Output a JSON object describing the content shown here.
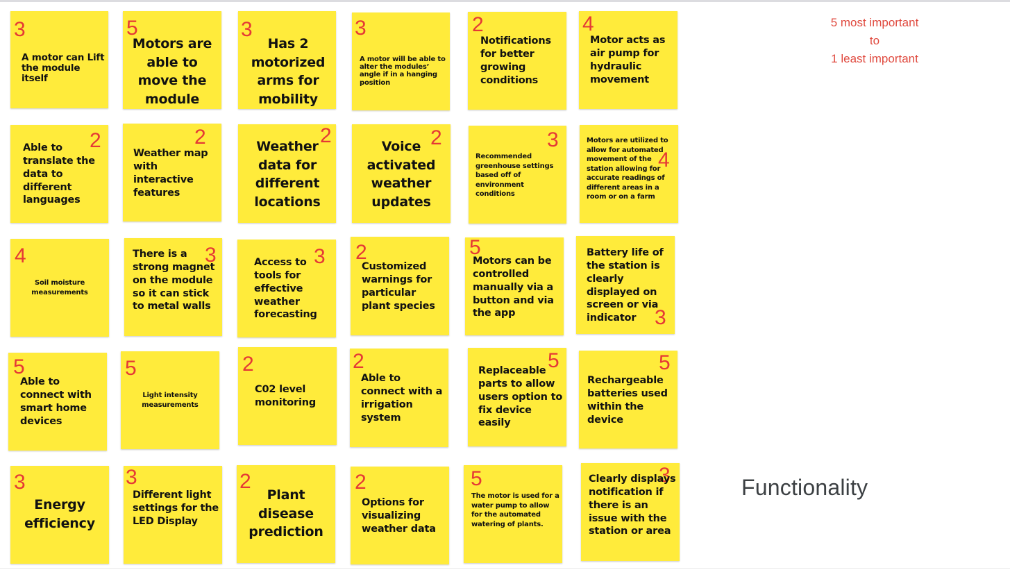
{
  "legend": {
    "line1": "5 most important",
    "line2": "to",
    "line3": "1 least important",
    "color": "#e04a3f"
  },
  "category_title": "Functionality",
  "note_color": "#ffeb3b",
  "score_color": "#e53935",
  "notes": [
    {
      "score": "3",
      "text": "A motor can Lift the module itself"
    },
    {
      "score": "5",
      "text": "Motors are able to move the module"
    },
    {
      "score": "3",
      "text": "Has 2 motorized arms for mobility"
    },
    {
      "score": "3",
      "text": "A motor will be able to alter the modules’ angle if in a hanging position"
    },
    {
      "score": "2",
      "text": "Notifications for better growing conditions"
    },
    {
      "score": "4",
      "text": "Motor acts as air pump for hydraulic movement"
    },
    {
      "score": "2",
      "text": "Able to translate the data to different languages"
    },
    {
      "score": "2",
      "text": "Weather map with interactive features"
    },
    {
      "score": "2",
      "text": "Weather data for different locations"
    },
    {
      "score": "2",
      "text": "Voice activated weather updates"
    },
    {
      "score": "3",
      "text": "Recommended greenhouse settings based off of environment conditions"
    },
    {
      "score": "4",
      "text": "Motors are utilized to allow for automated movement of the station allowing for accurate readings of different areas in a room or on a farm"
    },
    {
      "score": "4",
      "text": "Soil moisture measurements"
    },
    {
      "score": "3",
      "text": "There is a strong magnet on the module so it can stick to metal walls"
    },
    {
      "score": "3",
      "text": "Access to tools for effective weather forecasting"
    },
    {
      "score": "2",
      "text": "Customized warnings for particular plant species"
    },
    {
      "score": "5",
      "text": "Motors can be controlled manually via a button and via the app"
    },
    {
      "score": "3",
      "text": "Battery life of the station is clearly displayed on screen or via indicator"
    },
    {
      "score": "5",
      "text": "Able to connect with smart home devices"
    },
    {
      "score": "5",
      "text": "Light intensity measurements"
    },
    {
      "score": "2",
      "text": "C02 level monitoring"
    },
    {
      "score": "2",
      "text": "Able to connect with a irrigation system"
    },
    {
      "score": "5",
      "text": "Replaceable parts to allow users option to fix device easily"
    },
    {
      "score": "5",
      "text": "Rechargeable batteries used within the device"
    },
    {
      "score": "3",
      "text": "Energy efficiency"
    },
    {
      "score": "3",
      "text": "Different light settings for the LED Display"
    },
    {
      "score": "2",
      "text": "Plant disease prediction"
    },
    {
      "score": "2",
      "text": "Options for visualizing weather data"
    },
    {
      "score": "5",
      "text": "The motor is used for a water pump to allow for the automated watering of plants."
    },
    {
      "score": "3",
      "text": "Clearly displays notification if there is an issue with the station or area"
    }
  ]
}
